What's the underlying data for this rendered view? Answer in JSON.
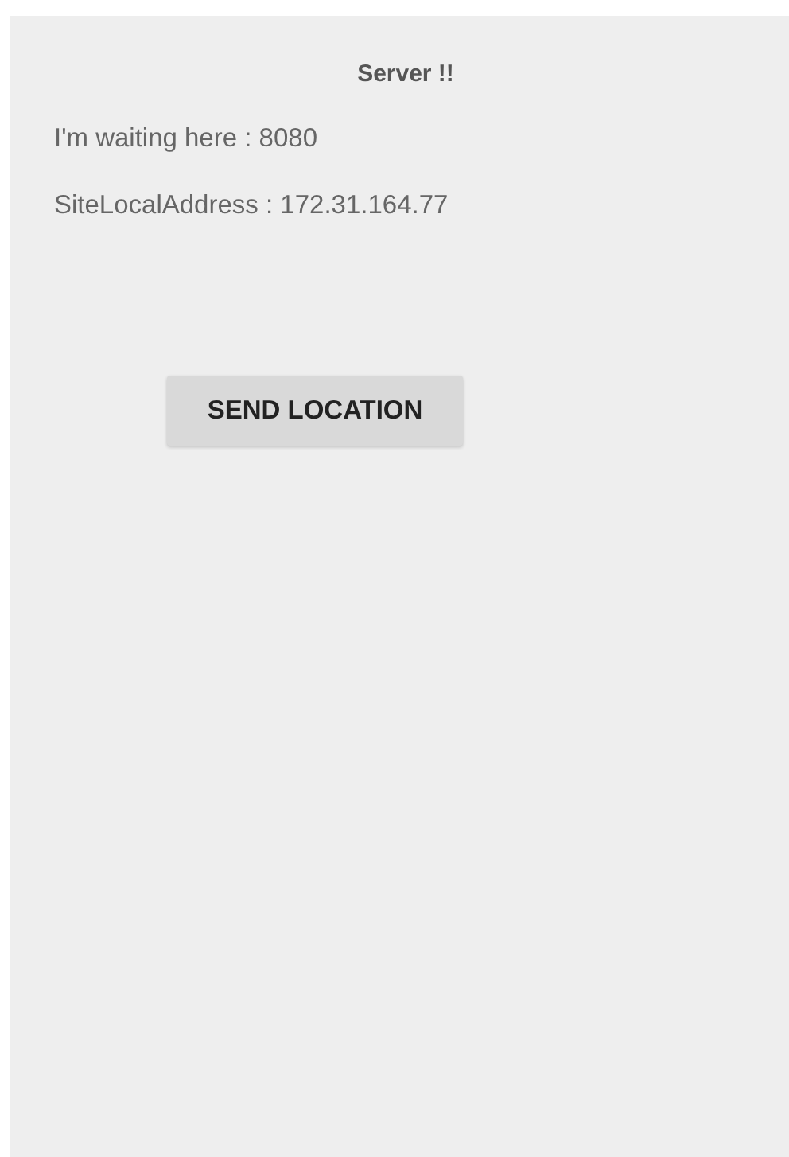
{
  "title": "Server !!",
  "lines": [
    "I'm waiting here : 8080",
    "SiteLocalAddress : 172.31.164.77"
  ],
  "button": {
    "label": "SEND LOCATION"
  }
}
